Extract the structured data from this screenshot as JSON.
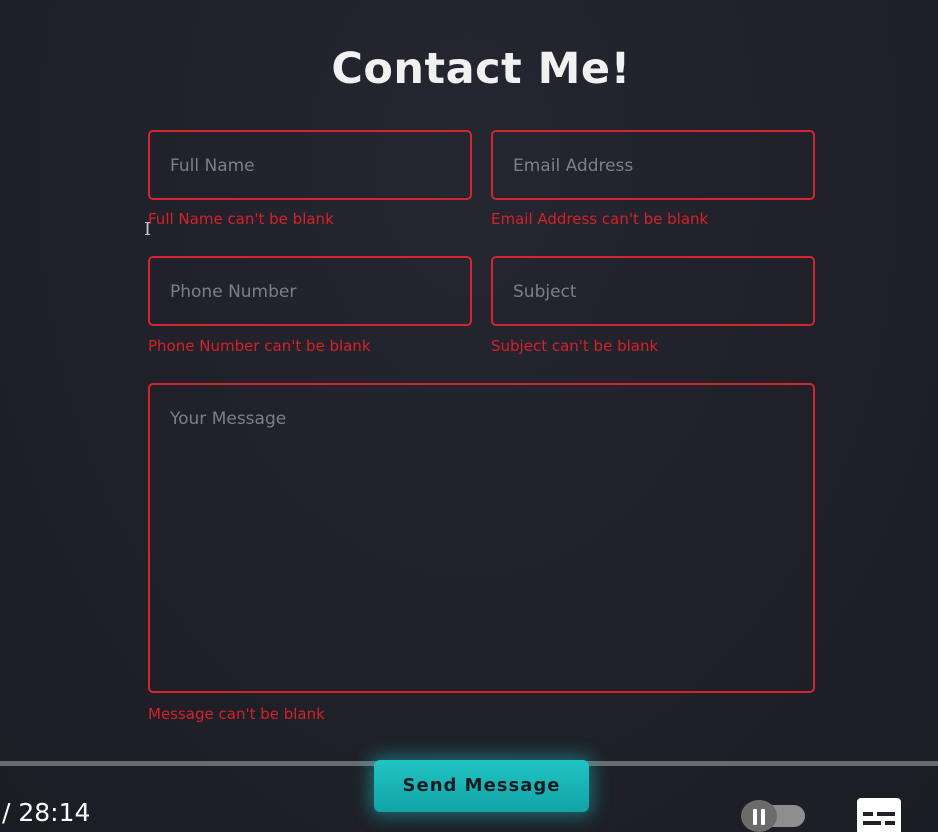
{
  "form": {
    "title": "Contact Me!",
    "fields": {
      "full_name": {
        "placeholder": "Full Name",
        "error": "Full Name can't be blank"
      },
      "email": {
        "placeholder": "Email Address",
        "error": "Email Address can't be blank"
      },
      "phone": {
        "placeholder": "Phone Number",
        "error": "Phone Number can't be blank"
      },
      "subject": {
        "placeholder": "Subject",
        "error": "Subject can't be blank"
      },
      "message": {
        "placeholder": "Your Message",
        "error": "Message can't be blank"
      }
    },
    "submit_label": "Send Message"
  },
  "player": {
    "time_display": "/ 28:14",
    "autoplay_icon": "pause-icon",
    "captions_icon": "subtitles-icon"
  },
  "colors": {
    "background": "#1f2028",
    "error": "#d6202a",
    "accent": "#21c4c4",
    "title": "#f1f1f1"
  }
}
